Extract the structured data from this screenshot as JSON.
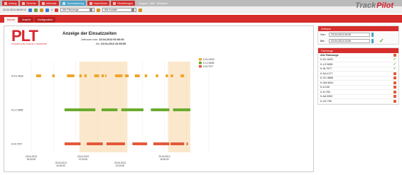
{
  "topnav": {
    "items": [
      {
        "label": "Anfang",
        "style": "red"
      },
      {
        "label": "Berichte",
        "style": "red"
      },
      {
        "label": "Administr.",
        "style": "red"
      },
      {
        "label": "Tourenplanung",
        "style": "blue"
      },
      {
        "label": "Nachrichten",
        "style": "red"
      },
      {
        "label": "Einstellungen",
        "style": "red"
      }
    ],
    "help": [
      "Support",
      "Hilfe",
      "Abmelden"
    ]
  },
  "toolbar": {
    "datetime": "23.04.2013 08:09:12",
    "counter": "4",
    "vehicle_select": "Alle Fahrzeuge",
    "customer_select": "Alle Kunden"
  },
  "logo": {
    "track": "Track",
    "pilot": "Pilot"
  },
  "tabs": [
    {
      "label": "Bericht",
      "active": true
    },
    {
      "label": "Ansicht",
      "active": false
    },
    {
      "label": "Konfiguration",
      "active": false
    }
  ],
  "report": {
    "company_logo_text": "PLT",
    "company_logo_sub": "PLANUNG FÜR LOGISTIK & TRANSPORT",
    "title": "Anzeige der Einsatzzeiten",
    "from_label": "Zeitraum vom:",
    "from_value": "23.04.2013 00:00:00",
    "to_label": "bis:",
    "to_value": "23.04.2013 23:59:59"
  },
  "sidebar": {
    "time_panel_title": "Zeitraum",
    "from_label": "Von:",
    "from_value": "23.04.2013  00:00",
    "to_label": "Bis:",
    "to_value": "23.04.2013  23:59",
    "vehicles_panel_title": "Fahrzeuge",
    "vehicles_header": "Alle Fahrzeuge",
    "vehicles": [
      {
        "name": "K-KU 4633",
        "selected": true
      },
      {
        "name": "K-LO 5655",
        "selected": true
      },
      {
        "name": "K-IN 7977",
        "selected": true
      },
      {
        "name": "K-DA 4177",
        "selected": false
      },
      {
        "name": "K-OC 8866",
        "selected": false
      },
      {
        "name": "K-GM 6631",
        "selected": false
      },
      {
        "name": "K-A 155",
        "selected": false
      },
      {
        "name": "K-M 755",
        "selected": false
      },
      {
        "name": "K-AA 3300",
        "selected": false
      },
      {
        "name": "K-CD 755",
        "selected": false
      }
    ]
  },
  "colors": {
    "red": "#d62c2c",
    "blue": "#4aa3c9",
    "bar_orange": "#f0a52a",
    "bar_green": "#6aab2e",
    "bar_red": "#e35a3b",
    "band": "#fbe8cc"
  },
  "chart_data": {
    "type": "gantt",
    "series": [
      {
        "name": "K-KU 4633",
        "color": "#f0a52a",
        "intervals": [
          [
            "00:40",
            "01:20"
          ],
          [
            "02:50",
            "03:10"
          ],
          [
            "04:50",
            "05:50"
          ],
          [
            "06:30",
            "06:50"
          ],
          [
            "07:10",
            "07:30"
          ],
          [
            "08:30",
            "09:10"
          ],
          [
            "09:30",
            "09:50"
          ],
          [
            "10:00",
            "10:10"
          ],
          [
            "11:20",
            "12:20"
          ],
          [
            "12:40",
            "13:10"
          ],
          [
            "14:00",
            "14:40"
          ],
          [
            "15:20",
            "15:40"
          ],
          [
            "16:50",
            "17:10"
          ],
          [
            "18:10",
            "18:30"
          ],
          [
            "18:50",
            "19:10"
          ],
          [
            "20:10",
            "20:40"
          ]
        ]
      },
      {
        "name": "K-LO 5655",
        "color": "#6aab2e",
        "intervals": [
          [
            "04:30",
            "08:40"
          ],
          [
            "09:30",
            "11:40"
          ],
          [
            "12:10",
            "15:10"
          ],
          [
            "16:10",
            "18:40"
          ],
          [
            "19:10",
            "21:30"
          ]
        ]
      },
      {
        "name": "K-IN 7977",
        "color": "#e35a3b",
        "intervals": [
          [
            "04:30",
            "06:40"
          ],
          [
            "07:30",
            "09:40"
          ],
          [
            "10:10",
            "12:40"
          ],
          [
            "13:40",
            "15:40"
          ],
          [
            "16:30",
            "18:40"
          ],
          [
            "18:50",
            "20:40"
          ],
          [
            "21:00",
            "21:10"
          ]
        ]
      }
    ],
    "bands": [
      [
        "06:30",
        "13:00"
      ],
      [
        "18:30",
        "21:30"
      ]
    ],
    "x_ticks": [
      {
        "date": "23.04.2013",
        "time": "00:00:00",
        "row": 1
      },
      {
        "date": "23.04.2013",
        "time": "04:00:00",
        "row": 2
      },
      {
        "date": "23.04.2013",
        "time": "07:00:00",
        "row": 1
      },
      {
        "date": "23.04.2013",
        "time": "12:00:00",
        "row": 2
      },
      {
        "date": "23.04.2013",
        "time": "18:00:00",
        "row": 1
      }
    ],
    "x_range": [
      "00:00",
      "24:00"
    ],
    "legend": [
      "K-KU 4633",
      "K-LO 5655",
      "K-IN 7977"
    ]
  }
}
